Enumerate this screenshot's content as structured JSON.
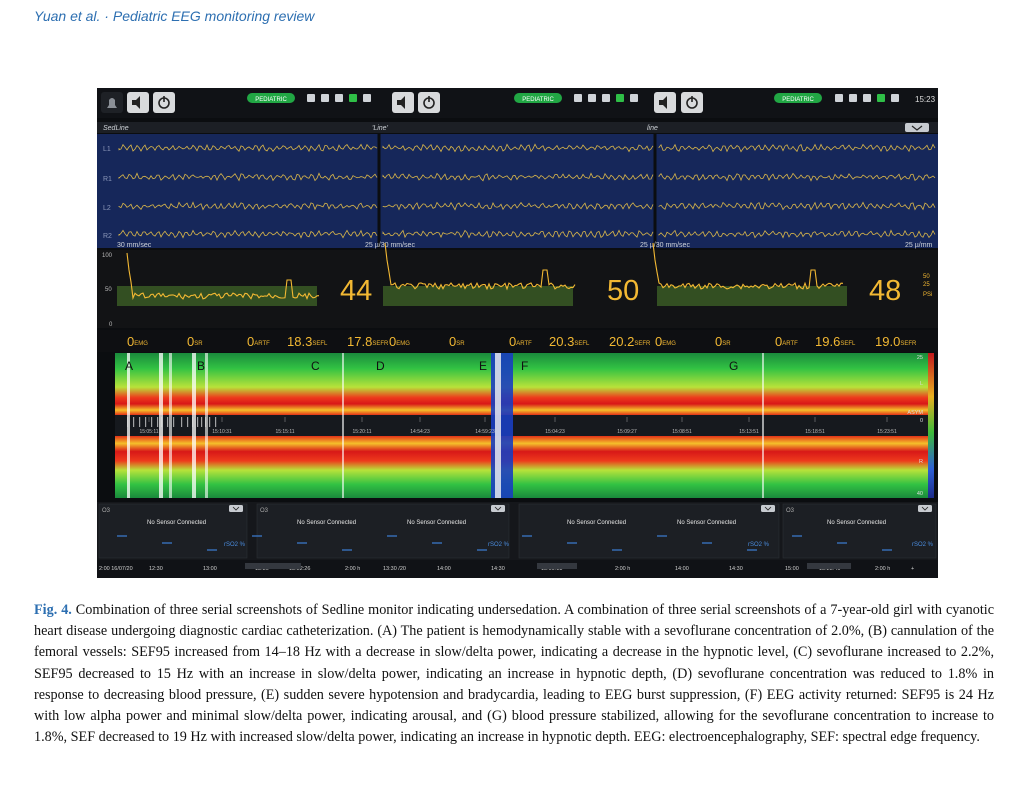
{
  "running_head": "Yuan et al. · Pediatric EEG monitoring review",
  "figure": {
    "label": "Fig. 4.",
    "caption": "Combination of three serial screenshots of Sedline monitor indicating undersedation. A combination of three serial screenshots of a 7-year-old girl with cyanotic heart disease undergoing diagnostic cardiac catheterization. (A) The patient is hemodynamically stable with a sevoflurane concentration of 2.0%, (B) cannulation of the femoral vessels: SEF95 increased from 14–18 Hz with a decrease in slow/delta power, indicating a decrease in the hypnotic level, (C) sevoflurane increased to 2.2%, SEF95 decreased to 15 Hz with an increase in slow/delta power, indicating an increase in hypnotic depth, (D) sevoflurane concentration was reduced to 1.8% in response to decreasing blood pressure, (E) sudden severe hypotension and bradycardia, leading to EEG burst suppression, (F) EEG activity returned: SEF95 is 24 Hz with low alpha power and minimal slow/delta power, indicating arousal, and (G) blood pressure stabilized, allowing for the sevoflurane concentration to increase to 1.8%, SEF decreased to 19 Hz with increased slow/delta power, indicating an increase in hypnotic depth. EEG: electroencephalography, SEF: spectral edge frequency."
  },
  "monitor": {
    "mode_badges": [
      "PEDIATRIC",
      "PEDIATRIC",
      "PEDIATRIC"
    ],
    "clock": "15:23",
    "panel_titles": [
      "SedLine",
      "'Line'",
      "line"
    ],
    "channels": [
      "L1",
      "R1",
      "L2",
      "R2"
    ],
    "speed_labels": [
      "30 mm/sec",
      "25 µ/30 mm/sec",
      "25 µ/30 mm/sec",
      "25 µ/mm"
    ],
    "y_ticks": [
      "100",
      "50",
      "0"
    ],
    "psi_values": [
      "44",
      "50",
      "48"
    ],
    "psi_side": [
      "50",
      "25",
      "PSi"
    ],
    "param_readouts": [
      "0EMG",
      "0SR",
      "0ARTF",
      "18.3SEFL",
      "17.8SEFR",
      "0EMG",
      "0SR",
      "0ARTF",
      "20.3SEFL",
      "20.2SEFR",
      "0EMG",
      "0SR",
      "0ARTF",
      "19.6SEFL",
      "19.0SEFR"
    ],
    "event_markers": [
      "A",
      "B",
      "C",
      "D",
      "E",
      "F",
      "G"
    ],
    "time_ticks": [
      "15:05:11",
      "15:10:31",
      "15:15:11",
      "15:20:11",
      "14:54:23",
      "14:59:23",
      "15:04:23",
      "15:09:27",
      "15:08:51",
      "15:13:51",
      "15:18:51",
      "15:23:51"
    ],
    "dsa_scale": [
      "25",
      "L",
      "ASYM",
      "0",
      "R",
      "40"
    ],
    "oxim_tag": "O3",
    "no_sensor_text": "No Sensor Connected",
    "rso2_label": "rSO2 %",
    "timeline_labels": [
      "2:00 16/07/20",
      "12:30",
      "13:00",
      "13:30",
      "13:52:26",
      "2:00 h",
      "13:30 /20",
      "14:00",
      "14:30",
      "15:09:18",
      "2:00 h",
      "14:00",
      "14:30",
      "15:00",
      "15:23:40",
      "2:00 h",
      "+"
    ]
  },
  "colors": {
    "accent": "#2d6fb1",
    "psi_yellow": "#f2b833",
    "eeg_bg": "#16275a",
    "badge_green": "#21a744"
  }
}
